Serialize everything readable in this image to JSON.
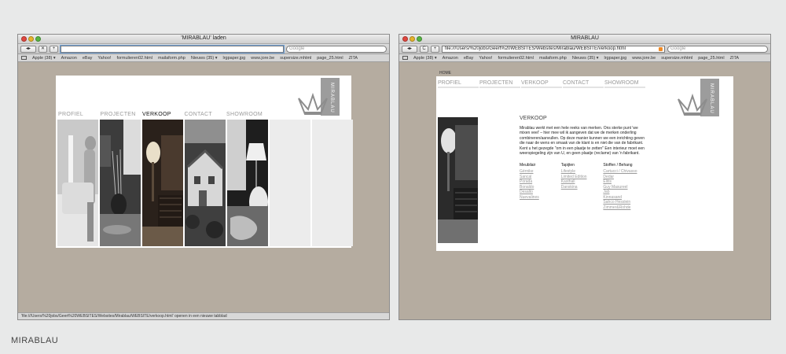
{
  "left_window": {
    "title": "'MIRABLAU' laden",
    "url": "",
    "search_placeholder": "Google",
    "buttons": {
      "back": "◂",
      "forward": "▸",
      "stop": "✕",
      "add": "+"
    },
    "bookmarks": [
      "Apple (38) ▾",
      "Amazon",
      "eBay",
      "Yahoo!",
      "formulieren02.html",
      "mailaform.php",
      "Nieuws (35) ▾",
      "lrgpaper.jpg",
      "www.jore.be",
      "supersize.mhtml",
      "page_25.html",
      "ZITA"
    ],
    "status": "'file:///Users/%20jobs/Geert%20WEBSITES/Websites/Mirablau/WEBSITE/verkoop.html' openen in een nieuwe tabblad",
    "logo_text": "MIRABLAU",
    "nav": [
      "PROFIEL",
      "PROJECTEN",
      "VERKOOP",
      "CONTACT",
      "SHOWROOM"
    ],
    "nav_active_index": 2
  },
  "right_window": {
    "title": "MIRABLAU",
    "url": "file:///Users/%20jobs/Geert%20WEBSITES/Websites/Mirablau/WEBSITE/verkoop.html",
    "search_placeholder": "Google",
    "buttons": {
      "back": "◂",
      "forward": "▸",
      "reload": "C",
      "add": "+"
    },
    "bookmarks": [
      "Apple (38) ▾",
      "Amazon",
      "eBay",
      "Yahoo!",
      "formulieren02.html",
      "mailaform.php",
      "Nieuws (35) ▾",
      "lrgpaper.jpg",
      "www.jore.be",
      "supersize.mhtml",
      "page_25.html",
      "ZITA"
    ],
    "breadcrumb": "HOME",
    "logo_text": "MIRABLAU",
    "nav": [
      "PROFIEL",
      "PROJECTEN",
      "VERKOOP",
      "CONTACT",
      "SHOWROOM"
    ],
    "heading": "VERKOOP",
    "body": "Mirablau werkt met een hele reeks van merken. Ons sterke punt 'we mixen veel' – hier mee wil ik aangeven dat we de merken onderling combineren/aanvullen. Op deze manier kunnen we een inrichting geven die naar de wens en smaak van de klant is en niet die van de fabrikant. Kent u het gezegde \"om in een plaatje te zetten\" Een interieur moet een weerspiegeling zijn van U, en geen plaatje (reclame) van 'n fabrikant.",
    "columns": [
      {
        "title": "Meubilair",
        "links": [
          "Gérnike",
          "Sancal",
          "Porada",
          "Bonaldo",
          "Desalto",
          "Nuevalines"
        ]
      },
      {
        "title": "Tapijten",
        "links": [
          "Lifestyle",
          "Limited Edition",
          "Kasthall",
          "Danskina"
        ]
      },
      {
        "title": "Stoffen / Behang",
        "links": [
          "Cartucci / Chivasso",
          "Dedar",
          "Elitis",
          "Guy Masureel",
          "Jab",
          "Kinnasand",
          "Sahco Hesslein",
          "Zimmer&Rohde"
        ]
      }
    ]
  },
  "caption": "MIRABLAU",
  "colors": {
    "backdrop": "#e8e9e9",
    "browser_bg": "#b5aca0",
    "logo_tile": "#9c9c9c",
    "link": "#9a9a9a"
  },
  "icons": [
    "back-arrow-icon",
    "forward-arrow-icon",
    "stop-icon",
    "reload-icon",
    "add-tab-icon",
    "book-icon",
    "rss-icon",
    "crown-logo-icon"
  ]
}
